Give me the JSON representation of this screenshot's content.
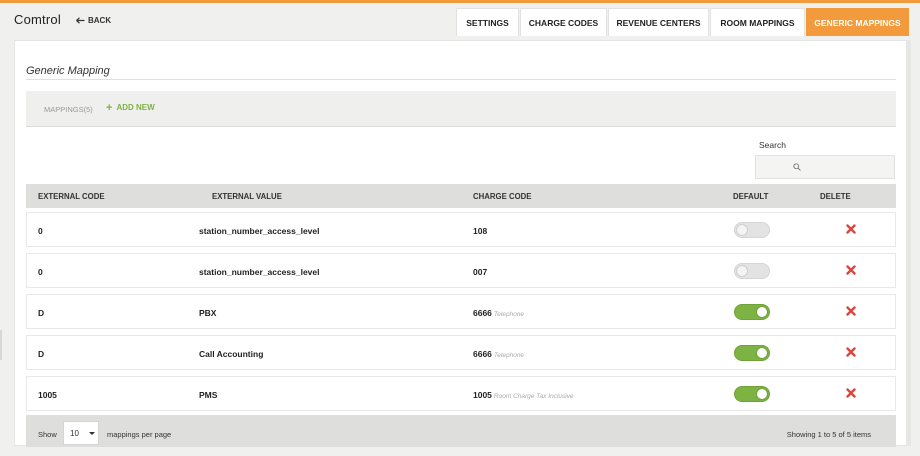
{
  "header": {
    "app_title": "Comtrol",
    "back_label": "BACK",
    "tabs": [
      {
        "label": "SETTINGS",
        "active": false
      },
      {
        "label": "CHARGE CODES",
        "active": false
      },
      {
        "label": "REVENUE CENTERS",
        "active": false
      },
      {
        "label": "ROOM MAPPINGS",
        "active": false
      },
      {
        "label": "GENERIC MAPPINGS",
        "active": true
      }
    ]
  },
  "colors": {
    "accent": "#f29a3c",
    "toggle_on": "#7cb342",
    "delete": "#d9473f"
  },
  "panel": {
    "title": "Generic Mapping",
    "mappings_count": "MAPPINGS(5)",
    "add_new": "ADD NEW"
  },
  "search": {
    "label": "Search",
    "placeholder": "",
    "icon": "search-icon"
  },
  "table": {
    "columns": [
      "EXTERNAL CODE",
      "EXTERNAL VALUE",
      "CHARGE CODE",
      "DEFAULT",
      "DELETE"
    ],
    "rows": [
      {
        "external_code": "0",
        "external_value": "station_number_access_level",
        "charge_code": "108",
        "charge_desc": "",
        "default": false
      },
      {
        "external_code": "0",
        "external_value": "station_number_access_level",
        "charge_code": "007",
        "charge_desc": "",
        "default": false
      },
      {
        "external_code": "D",
        "external_value": "PBX",
        "charge_code": "6666",
        "charge_desc": "Telephone",
        "default": true
      },
      {
        "external_code": "D",
        "external_value": "Call Accounting",
        "charge_code": "6666",
        "charge_desc": "Telephone",
        "default": true
      },
      {
        "external_code": "1005",
        "external_value": "PMS",
        "charge_code": "1005",
        "charge_desc": "Room Charge Tax Inclusive",
        "default": true
      }
    ]
  },
  "footer": {
    "show_label": "Show",
    "page_size": "10",
    "per_page_label": "mappings per page",
    "showing_text": "Showing 1 to 5 of 5 items"
  }
}
